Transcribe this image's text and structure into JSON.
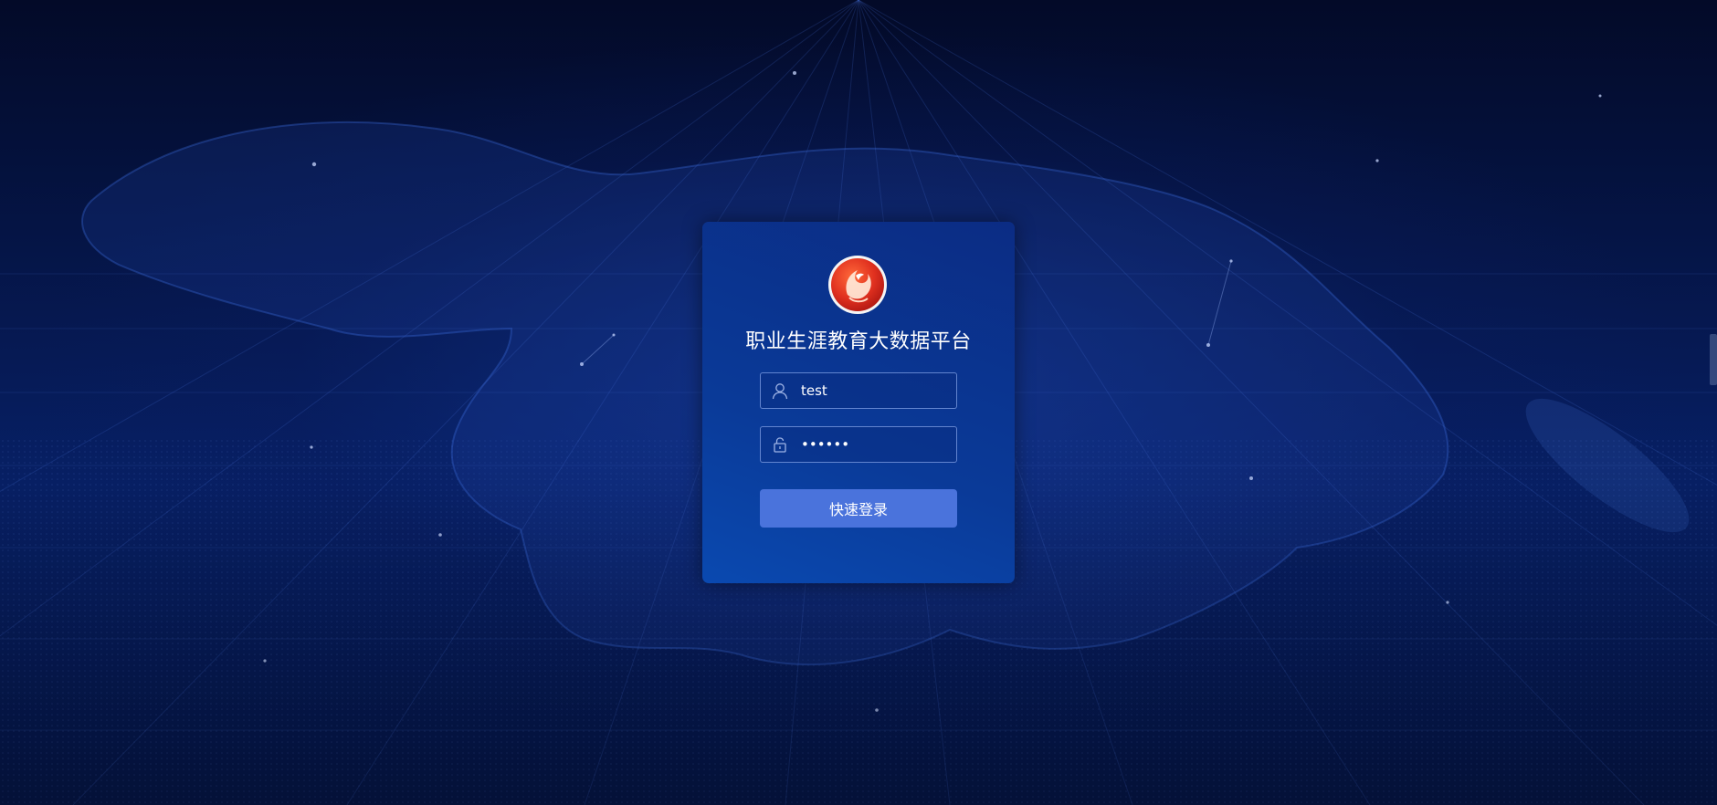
{
  "app": {
    "title": "职业生涯教育大数据平台"
  },
  "login": {
    "username_value": "test",
    "password_value": "••••••",
    "submit_label": "快速登录"
  },
  "icons": {
    "logo": "phoenix-logo",
    "username": "user-icon",
    "password": "lock-icon"
  },
  "colors": {
    "background": "#061a55",
    "card": "#0a3a98",
    "button": "#4a73dc",
    "logo_red": "#d9251c"
  }
}
